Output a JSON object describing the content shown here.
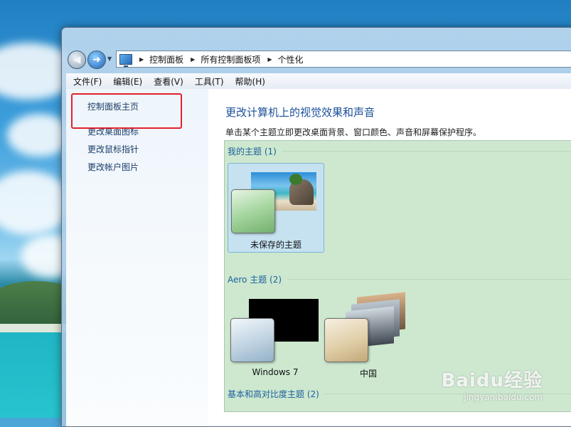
{
  "address": {
    "crumbs": [
      "控制面板",
      "所有控制面板项",
      "个性化"
    ]
  },
  "menubar": {
    "items": [
      "文件(F)",
      "编辑(E)",
      "查看(V)",
      "工具(T)",
      "帮助(H)"
    ]
  },
  "sidebar": {
    "links": [
      "控制面板主页",
      "更改桌面图标",
      "更改鼠标指针",
      "更改帐户图片"
    ]
  },
  "main": {
    "title": "更改计算机上的视觉效果和声音",
    "subtitle": "单击某个主题立即更改桌面背景、窗口颜色、声音和屏幕保护程序。",
    "groups": {
      "mine": {
        "label": "我的主题 (1)",
        "themes": [
          "未保存的主题"
        ]
      },
      "aero": {
        "label": "Aero 主题 (2)",
        "themes": [
          "Windows 7",
          "中国"
        ]
      },
      "basic": {
        "label": "基本和高对比度主题 (2)"
      }
    }
  },
  "watermark": {
    "logo": "Baidu经验",
    "url": "jingyan.baidu.com"
  },
  "colors": {
    "highlight_box": "#e3212b",
    "link": "#1b3d6a",
    "title": "#1a4f98",
    "panel": "#cde8cf"
  }
}
